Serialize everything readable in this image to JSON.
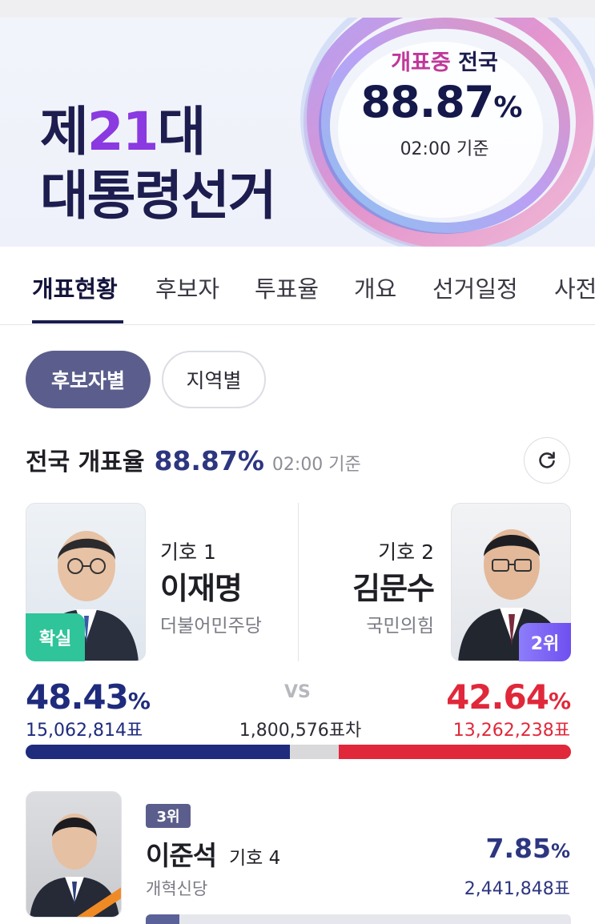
{
  "banner": {
    "title_line1_pre": "제",
    "title_line1_num": "21",
    "title_line1_post": "대",
    "title_line2": "대통령선거",
    "count_prefix": "개표중",
    "count_scope": "전국",
    "count_percent": "88.87",
    "count_unit": "%",
    "count_time": "02:00 기준"
  },
  "tabs": [
    {
      "label": "개표현황",
      "active": true
    },
    {
      "label": "후보자",
      "active": false
    },
    {
      "label": "투표율",
      "active": false
    },
    {
      "label": "개요",
      "active": false
    },
    {
      "label": "선거일정",
      "active": false
    },
    {
      "label": "사전",
      "active": false
    }
  ],
  "segments": {
    "by_candidate": "후보자별",
    "by_region": "지역별",
    "selected": "후보자별"
  },
  "rate": {
    "label": "전국 개표율",
    "value": "88.87%",
    "time": "02:00 기준",
    "refresh_icon": "refresh-icon"
  },
  "candidates": [
    {
      "number_label": "기호 1",
      "name": "이재명",
      "party": "더불어민주당",
      "badge": "확실",
      "percent": "48.43",
      "unit": "%",
      "votes": "15,062,814표",
      "share": 48.43,
      "color": "#1f2b7d"
    },
    {
      "number_label": "기호 2",
      "name": "김문수",
      "party": "국민의힘",
      "badge": "2위",
      "percent": "42.64",
      "unit": "%",
      "votes": "13,262,238표",
      "share": 42.64,
      "color": "#e0283a"
    }
  ],
  "vs_label": "VS",
  "difference": "1,800,576표차",
  "third": {
    "rank": "3위",
    "name": "이준석",
    "number_label": "기호 4",
    "party": "개혁신당",
    "percent": "7.85",
    "unit": "%",
    "votes": "2,441,848표",
    "share": 7.85
  }
}
